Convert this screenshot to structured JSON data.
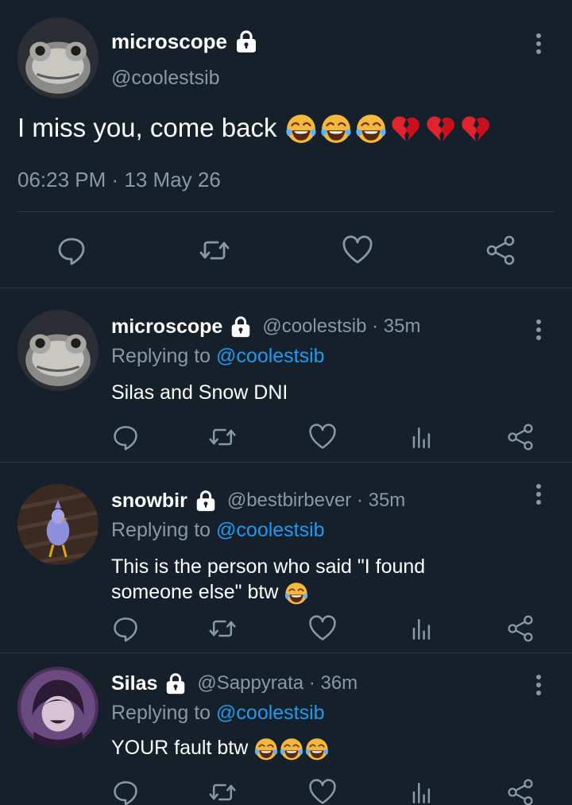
{
  "main_tweet": {
    "name": "microscope",
    "handle": "@coolestsib",
    "text": "I miss you, come back",
    "emojis": [
      "laughing-crying",
      "laughing-crying",
      "laughing-crying",
      "broken-heart",
      "broken-heart",
      "broken-heart"
    ],
    "timestamp": "06:23 PM · 13 May 26"
  },
  "replies": [
    {
      "name": "microscope",
      "handle_time": "@coolestsib · 35m",
      "replying_prefix": "Replying to ",
      "replying_to": "@coolestsib",
      "text_line1": "Silas and Snow DNI",
      "text_line2": "",
      "emojis": []
    },
    {
      "name": "snowbir",
      "handle_time": "@bestbirbever · 35m",
      "replying_prefix": "Replying to ",
      "replying_to": "@coolestsib",
      "text_line1": "This is the person who said \"I found",
      "text_line2": "someone else\" btw",
      "emojis": [
        "laughing-crying"
      ]
    },
    {
      "name": "Silas",
      "handle_time": "@Sappyrata · 36m",
      "replying_prefix": "Replying to ",
      "replying_to": "@coolestsib",
      "text_line1": "YOUR fault btw",
      "text_line2": "",
      "emojis": [
        "laughing-crying",
        "laughing-crying",
        "laughing-crying"
      ]
    }
  ],
  "icons": {
    "main_actions": [
      "reply-icon",
      "retweet-icon",
      "like-icon",
      "share-icon"
    ],
    "reply_actions": [
      "reply-icon",
      "retweet-icon",
      "like-icon",
      "analytics-icon",
      "share-icon"
    ]
  },
  "colors": {
    "background": "#15202b",
    "divider": "#2f3b47",
    "text_primary": "#ffffff",
    "text_secondary": "#8899a6",
    "link": "#1d9bf0"
  }
}
